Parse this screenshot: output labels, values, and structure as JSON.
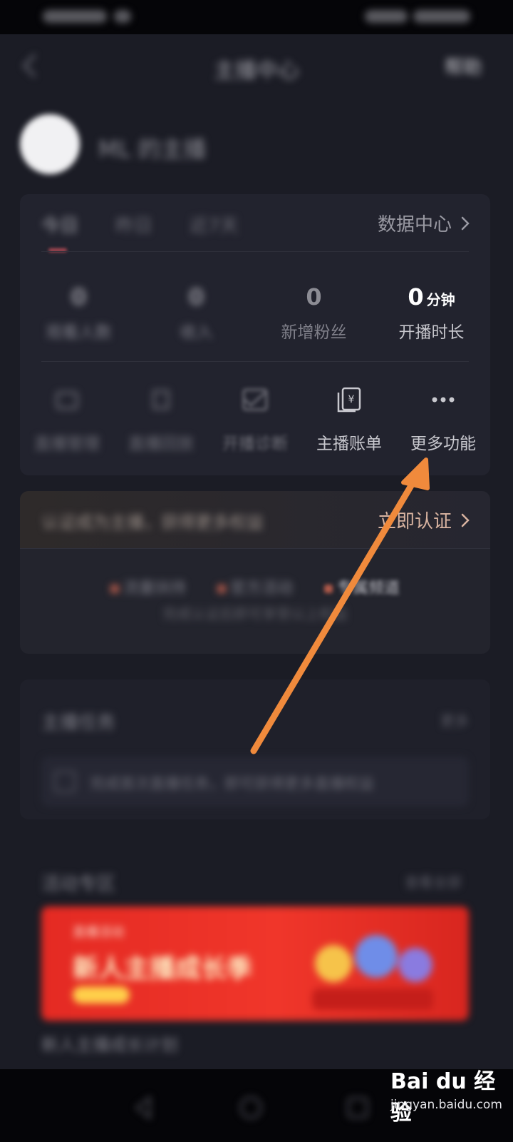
{
  "status_bar": {},
  "header": {
    "title": "主播中心",
    "action_label": "帮助"
  },
  "profile": {
    "name": "ML 的主播"
  },
  "data_card": {
    "tabs": [
      {
        "label": "今日",
        "active": true
      },
      {
        "label": "昨日",
        "active": false
      },
      {
        "label": "近7天",
        "active": false
      }
    ],
    "data_center_label": "数据中心",
    "stats": [
      {
        "value": "0",
        "unit": "",
        "label": "观看人数"
      },
      {
        "value": "0",
        "unit": "",
        "label": "收入"
      },
      {
        "value": "0",
        "unit": "",
        "label": "新增粉丝"
      },
      {
        "value": "0",
        "unit": "分钟",
        "label": "开播时长"
      }
    ],
    "tools": [
      {
        "label": "直播管理",
        "icon": "live-manage-icon"
      },
      {
        "label": "直播回放",
        "icon": "replay-icon"
      },
      {
        "label": "开播诊断",
        "icon": "diagnose-icon"
      },
      {
        "label": "主播账单",
        "icon": "bill-icon"
      },
      {
        "label": "更多功能",
        "icon": "more-icon"
      }
    ]
  },
  "verify_card": {
    "text": "认证成为主播，获得更多权益",
    "link_label": "立即认证",
    "perks": [
      "流量扶持",
      "官方活动",
      "专属频道"
    ],
    "description": "完成认证后即可享受以上权益"
  },
  "tasks_card": {
    "title": "主播任务",
    "more_label": "更多",
    "task_text": "完成首次直播任务，即可获得更多直播权益"
  },
  "promo": {
    "title": "活动专区",
    "more_label": "查看全部",
    "banner_sub": "直播活动",
    "banner_headline": "新人主播成长季",
    "caption": "新人主播成长计划"
  },
  "watermark": {
    "logo": "Bai du 经验",
    "url": "jingyan.baidu.com"
  },
  "colors": {
    "background": "#1b1c25",
    "card": "#22232e",
    "annotation_arrow": "#f08a3c",
    "banner": "#e42a23"
  }
}
